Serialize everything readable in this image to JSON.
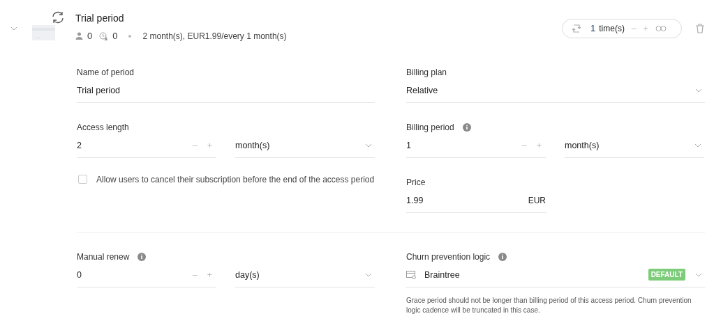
{
  "header": {
    "expanded": true,
    "title": "Trial period",
    "users_count": "0",
    "renewals_count": "0",
    "summary": "2 month(s), EUR1.99/every 1 month(s)",
    "repeat": {
      "count": "1",
      "unit": "time(s)",
      "minus": "–",
      "plus": "+"
    }
  },
  "name_of_period": {
    "label": "Name of period",
    "value": "Trial period"
  },
  "billing_plan": {
    "label": "Billing plan",
    "value": "Relative"
  },
  "access_length": {
    "label": "Access length",
    "value": "2",
    "minus": "–",
    "plus": "+",
    "unit": "month(s)"
  },
  "billing_period": {
    "label": "Billing period",
    "value": "1",
    "minus": "–",
    "plus": "+",
    "unit": "month(s)"
  },
  "allow_cancel": {
    "label": "Allow users to cancel their subscription before the end of the access period",
    "checked": false
  },
  "price": {
    "label": "Price",
    "value": "1.99",
    "currency": "EUR"
  },
  "manual_renew": {
    "label": "Manual renew",
    "value": "0",
    "minus": "–",
    "plus": "+",
    "unit": "day(s)"
  },
  "churn": {
    "label": "Churn prevention logic",
    "value": "Braintree",
    "badge": "DEFAULT",
    "note": "Grace period should not be longer than billing period of this access period. Churn prevention logic cadence will be truncated in this case."
  }
}
